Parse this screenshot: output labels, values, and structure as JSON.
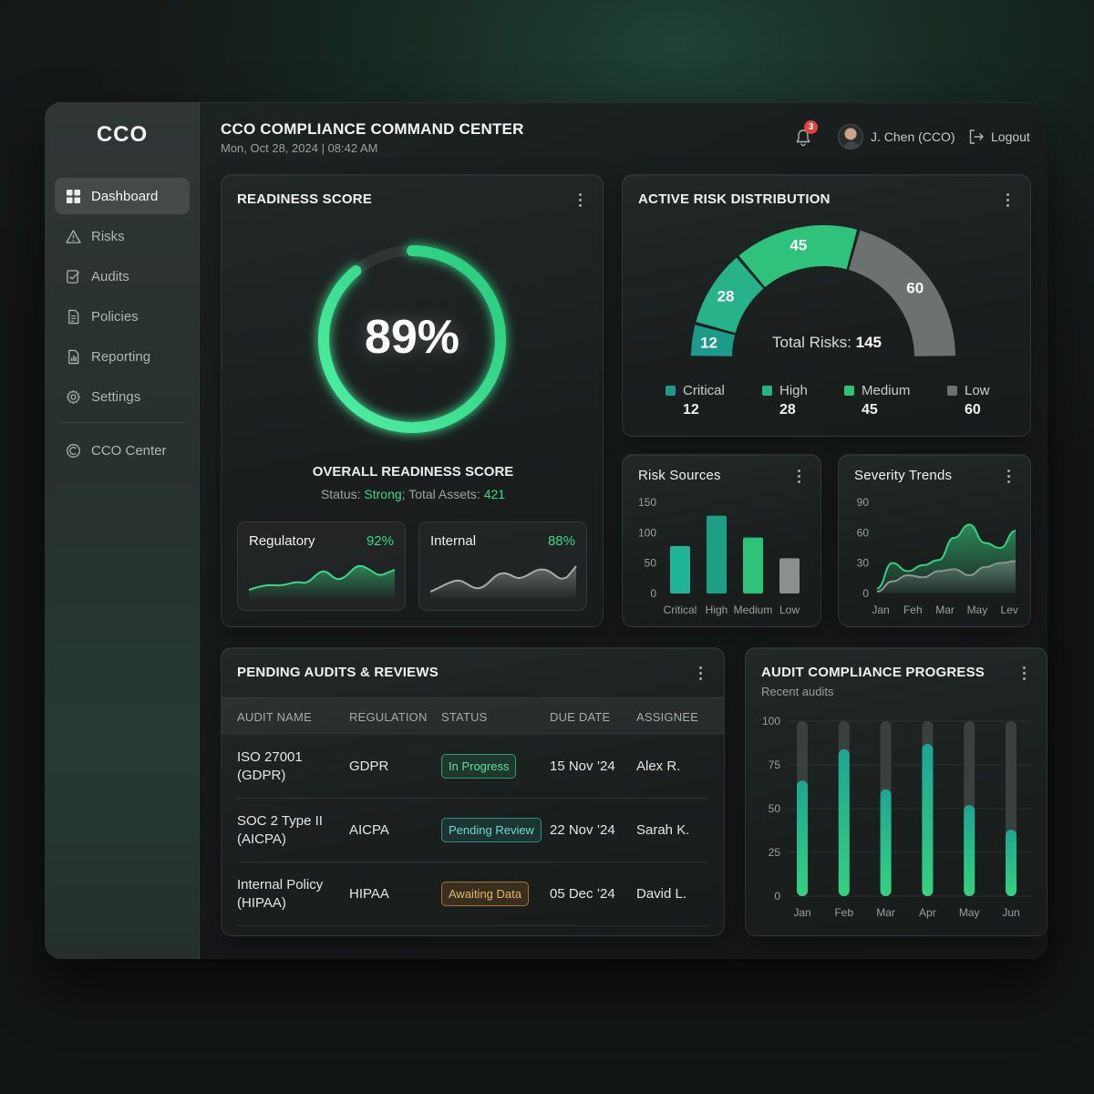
{
  "app": {
    "brand": "CCO",
    "title": "CCO COMPLIANCE COMMAND CENTER",
    "datetime": "Mon, Oct 28, 2024 | 08:42 AM"
  },
  "sidebar": {
    "items": [
      {
        "label": "Dashboard",
        "icon": "dashboard-grid-icon",
        "active": true
      },
      {
        "label": "Risks",
        "icon": "warning-triangle-icon"
      },
      {
        "label": "Audits",
        "icon": "audit-checklist-icon"
      },
      {
        "label": "Policies",
        "icon": "policy-document-icon"
      },
      {
        "label": "Reporting",
        "icon": "report-chart-icon"
      },
      {
        "label": "Settings",
        "icon": "gear-icon"
      }
    ],
    "footer_item": {
      "label": "CCO Center",
      "icon": "cco-center-icon"
    }
  },
  "header": {
    "notifications_count": "3",
    "user_name": "J. Chen (CCO)",
    "logout_label": "Logout"
  },
  "colors": {
    "accent": "#3fd68a",
    "teal": "#1fa592",
    "low_gray": "#6b7270",
    "critical": "#1d9a8a",
    "high": "#27b28a",
    "medium": "#2ec27a"
  },
  "readiness": {
    "title": "READINESS SCORE",
    "score_label": "89%",
    "score_fraction": 0.89,
    "overall_label": "OVERALL READINESS SCORE",
    "status_prefix": "Status: ",
    "status_value": "Strong",
    "assets_prefix": "; Total Assets: ",
    "assets_value": "421",
    "regulatory": {
      "label": "Regulatory",
      "value": "92%"
    },
    "internal": {
      "label": "Internal",
      "value": "88%"
    }
  },
  "risk_distribution": {
    "title": "ACTIVE RISK DISTRIBUTION",
    "total_prefix": "Total Risks: ",
    "total_value": "145",
    "legend": [
      {
        "label": "Critical",
        "value": "12",
        "color": "#1d9a8a"
      },
      {
        "label": "High",
        "value": "28",
        "color": "#27b28a"
      },
      {
        "label": "Medium",
        "value": "45",
        "color": "#2ec27a"
      },
      {
        "label": "Low",
        "value": "60",
        "color": "#6b7270"
      }
    ]
  },
  "pending_audits": {
    "title": "PENDING AUDITS & REVIEWS",
    "columns": [
      "AUDIT NAME",
      "REGULATION",
      "STATUS",
      "DUE DATE",
      "ASSIGNEE"
    ],
    "rows": [
      {
        "name_line1": "ISO 27001",
        "name_line2": "(GDPR)",
        "regulation": "GDPR",
        "status": "In Progress",
        "status_style": "green",
        "due": "15 Nov ’24",
        "assignee": "Alex R."
      },
      {
        "name_line1": "SOC 2 Type II",
        "name_line2": "(AICPA)",
        "regulation": "AICPA",
        "status": "Pending Review",
        "status_style": "teal",
        "due": "22 Nov ’24",
        "assignee": "Sarah K."
      },
      {
        "name_line1": "Internal Policy",
        "name_line2": "(HIPAA)",
        "regulation": "HIPAA",
        "status": "Awaiting Data",
        "status_style": "amber",
        "due": "05 Dec ’24",
        "assignee": "David L."
      }
    ]
  },
  "chart_data": [
    {
      "id": "risk_distribution",
      "type": "pie",
      "title": "ACTIVE RISK DISTRIBUTION",
      "categories": [
        "Critical",
        "High",
        "Medium",
        "Low"
      ],
      "values": [
        12,
        28,
        45,
        60
      ],
      "colors": [
        "#1d9a8a",
        "#27b28a",
        "#2ec27a",
        "#6b7270"
      ]
    },
    {
      "id": "risk_sources",
      "type": "bar",
      "title": "Risk Sources",
      "categories": [
        "Critical",
        "High",
        "Medium",
        "Low"
      ],
      "values": [
        78,
        128,
        92,
        58
      ],
      "colors": [
        "#1fb596",
        "#1d9f83",
        "#2ec27a",
        "#8a908f"
      ],
      "ylim": [
        0,
        150
      ],
      "yticks": [
        "150",
        "100",
        "50",
        "0"
      ]
    },
    {
      "id": "severity_trends",
      "type": "area",
      "title": "Severity Trends",
      "x": [
        "Jan",
        "Feh",
        "Mar",
        "May",
        "Lev"
      ],
      "series": [
        {
          "values": [
            5,
            30,
            22,
            28,
            33,
            55,
            68,
            50,
            45,
            62
          ],
          "color": "#35d07f"
        },
        {
          "values": [
            2,
            12,
            18,
            16,
            22,
            24,
            18,
            26,
            30,
            32
          ],
          "color": "#8d9592"
        }
      ],
      "ylim": [
        0,
        90
      ],
      "yticks": [
        "90",
        "60",
        "30",
        "0"
      ]
    },
    {
      "id": "audit_compliance",
      "type": "bar",
      "title": "AUDIT COMPLIANCE PROGRESS",
      "subtitle": "Recent audits",
      "categories": [
        "Jan",
        "Feb",
        "Mar",
        "Apr",
        "May",
        "Jun"
      ],
      "values": [
        66,
        84,
        61,
        87,
        52,
        38
      ],
      "ylim": [
        0,
        100
      ],
      "yticks": [
        "100",
        "75",
        "50",
        "25",
        "0"
      ]
    }
  ]
}
